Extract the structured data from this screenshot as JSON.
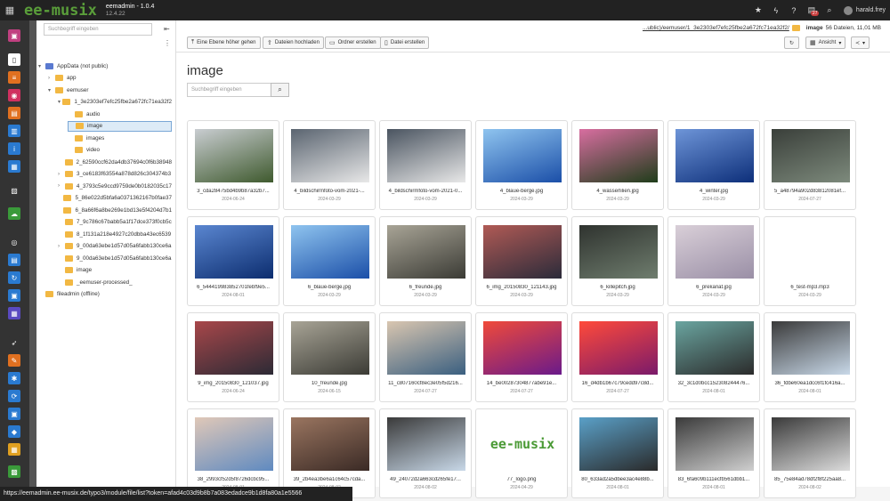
{
  "topbar": {
    "logo": "ee-musix",
    "site_name": "eemadmin - 1.0.4",
    "version": "12.4.22",
    "badge": "27",
    "user": "harald.frey"
  },
  "tree": {
    "search_placeholder": "Suchbegriff eingeben",
    "nodes": [
      {
        "label": "AppData (not public)",
        "level": 0,
        "arrow": "▾"
      },
      {
        "label": "app",
        "level": 1,
        "arrow": "›"
      },
      {
        "label": "eemuser",
        "level": 1,
        "arrow": "▾"
      },
      {
        "label": "1_3e2303ef7efc25fbe2a672fc71ea32f2",
        "level": 2,
        "arrow": "▾"
      },
      {
        "label": "audio",
        "level": 3,
        "arrow": ""
      },
      {
        "label": "image",
        "level": 3,
        "arrow": "",
        "selected": true
      },
      {
        "label": "images",
        "level": 3,
        "arrow": ""
      },
      {
        "label": "video",
        "level": 3,
        "arrow": ""
      },
      {
        "label": "2_62590ccf62da4db37694c0f6b38948",
        "level": 2,
        "arrow": ""
      },
      {
        "label": "3_ce6183f63554a878d826c304374b3",
        "level": 2,
        "arrow": "›"
      },
      {
        "label": "4_3793c5e9ccd9759de0b0182035c17",
        "level": 2,
        "arrow": "›"
      },
      {
        "label": "5_86e022d5bfa6a0371362167b0fae37",
        "level": 2,
        "arrow": ""
      },
      {
        "label": "6_8a66f6a8be269e1bd13e5f4204d7b1",
        "level": 2,
        "arrow": ""
      },
      {
        "label": "7_9c786c67babb5a1f17dce373f0cb5c",
        "level": 2,
        "arrow": ""
      },
      {
        "label": "8_1f131a218e4927c20dbba43ec6539",
        "level": 2,
        "arrow": ""
      },
      {
        "label": "9_00da63ebe1d57d05a6fabb130ce6a",
        "level": 2,
        "arrow": "›"
      },
      {
        "label": "9_00da63ebe1d57d05a6fabb130ce6a",
        "level": 2,
        "arrow": ""
      },
      {
        "label": "image",
        "level": 2,
        "arrow": ""
      },
      {
        "label": "_eemuser-processed_",
        "level": 2,
        "arrow": ""
      },
      {
        "label": "fileadmin (offline)",
        "level": 0,
        "arrow": ""
      }
    ]
  },
  "toolbar": {
    "up": "Eine Ebene höher gehen",
    "upload": "Dateien hochladen",
    "newfolder": "Ordner erstellen",
    "newfile": "Datei erstellen",
    "path": "...ublic)/eemuser/1_3e2303ef7efc25fbe2a672fc71ea32f2/",
    "folder": "image",
    "count": "56 Dateien, 11,01 MB",
    "view": "Ansicht"
  },
  "main": {
    "title": "image",
    "search_placeholder": "Suchbegriff eingeben"
  },
  "files": [
    {
      "name": "3_cda28475bd4b9b87a32b7...",
      "date": "2024-06-24",
      "c1": "#3f5a2e",
      "c2": "#c9cdd1"
    },
    {
      "name": "4_bildschirmfoto-vom-2021-...",
      "date": "2024-03-29",
      "c1": "#e8e8e8",
      "c2": "#5a6470"
    },
    {
      "name": "4_bildschirmfoto-vom-2021-0...",
      "date": "2024-03-29",
      "c1": "#e8e8e8",
      "c2": "#4a5460"
    },
    {
      "name": "4_blaue-berge.jpg",
      "date": "2024-03-29",
      "c1": "#1b4fa8",
      "c2": "#8fc4ef"
    },
    {
      "name": "4_wasserlilien.jpg",
      "date": "2024-03-29",
      "c1": "#1f3d1a",
      "c2": "#d86ea0"
    },
    {
      "name": "4_winter.jpg",
      "date": "2024-03-29",
      "c1": "#0d2f7a",
      "c2": "#6e95d8"
    },
    {
      "name": "5_a48794a902d83812081ef...",
      "date": "2024-07-27",
      "c1": "#7d8a7c",
      "c2": "#3a3f3a"
    },
    {
      "name": "6_544419983852701febf9e5...",
      "date": "2024-08-01",
      "c1": "#0c2d6f",
      "c2": "#5a86d0"
    },
    {
      "name": "6_blaue-berge.jpg",
      "date": "2024-03-29",
      "c1": "#1b4fa8",
      "c2": "#8fc4ef"
    },
    {
      "name": "6_freunde.jpg",
      "date": "2024-03-29",
      "c1": "#3b3b35",
      "c2": "#a8a496"
    },
    {
      "name": "6_img_20150830_121143.jpg",
      "date": "2024-03-29",
      "c1": "#2b2b3a",
      "c2": "#b05a55"
    },
    {
      "name": "6_killepitch.jpg",
      "date": "2024-03-29",
      "c1": "#6f7d6e",
      "c2": "#2f332f"
    },
    {
      "name": "6_prekariat.jpg",
      "date": "2024-03-29",
      "c1": "#9a8fa6",
      "c2": "#d9cfd8"
    },
    {
      "name": "6_test-mp3.mp3",
      "date": "2024-03-29",
      "c1": "#ffffff",
      "c2": "#ffffff"
    },
    {
      "name": "9_img_20150830_121037.jpg",
      "date": "2024-06-24",
      "c1": "#2c2a35",
      "c2": "#a8474a"
    },
    {
      "name": "10_freunde.jpg",
      "date": "2024-06-15",
      "c1": "#3b3b35",
      "c2": "#a8a496"
    },
    {
      "name": "11_c807160cf8ec3e05f5d216...",
      "date": "2024-07-27",
      "c1": "#3a5f80",
      "c2": "#d9c6b0"
    },
    {
      "name": "14_be00287304877abe91e...",
      "date": "2024-07-27",
      "c1": "#6a1a8a",
      "c2": "#f04a3a"
    },
    {
      "name": "16_d4db1b67c79cedd97c8d...",
      "date": "2024-07-27",
      "c1": "#7a1a6a",
      "c2": "#ff4a3a"
    },
    {
      "name": "32_3c1d0bcc152308244476...",
      "date": "2024-08-01",
      "c1": "#2b2b2b",
      "c2": "#6aa5a0"
    },
    {
      "name": "36_fdbe60ea1dcc6f1fc416a...",
      "date": "2024-08-01",
      "c1": "#c8d8e8",
      "c2": "#3a3a3a"
    },
    {
      "name": "38_2993cf52d5f8726dcbc95...",
      "date": "2024-08-01",
      "c1": "#5f8ac0",
      "c2": "#e0c8b8"
    },
    {
      "name": "39_2b4ea3be6a1c64c57cda...",
      "date": "2024-08-02",
      "c1": "#3a2a25",
      "c2": "#9a7560"
    },
    {
      "name": "49_24072d2a663cd265fe17...",
      "date": "2024-08-02",
      "c1": "#c8d8e8",
      "c2": "#3a3a3a"
    },
    {
      "name": "77_logo.png",
      "date": "2024-04-29",
      "c1": "#ffffff",
      "c2": "#ffffff"
    },
    {
      "name": "80_633ad2a5dbee3ac4e88b...",
      "date": "2024-08-01",
      "c1": "#2a2a2a",
      "c2": "#5aa0c8"
    },
    {
      "name": "83_6fa609b111ecfb561dbb1...",
      "date": "2024-08-01",
      "c1": "#cfcfcf",
      "c2": "#3a3a3a"
    },
    {
      "name": "85_75e84ad78df2f8f225aa8...",
      "date": "2024-08-02",
      "c1": "#dcdcdc",
      "c2": "#3a3a3a"
    }
  ],
  "logo_text": "ee-musix",
  "status_url": "https://eemadmin.ee-musix.de/typo3/module/file/list?token=afad4c03d9b8b7a083edadce9b1d8fa80a1e5566"
}
